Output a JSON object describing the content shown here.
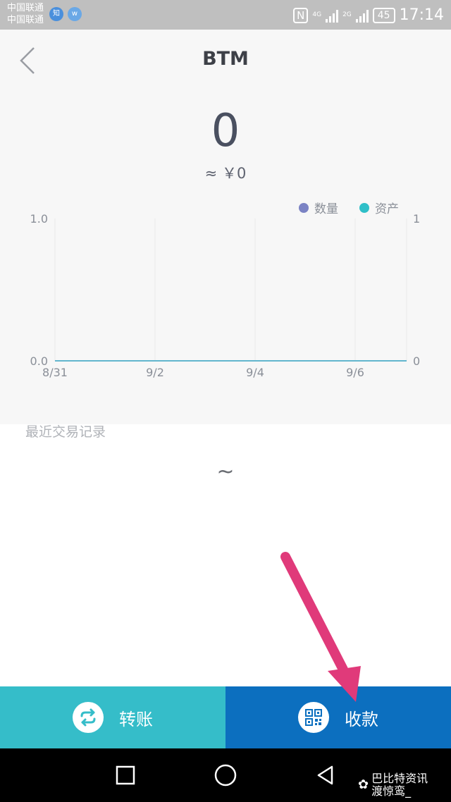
{
  "status_bar": {
    "carrier_1": "中国联通",
    "carrier_2": "中国联通",
    "app_icon_1": "知",
    "app_icon_2": "w",
    "network_1": "4G",
    "network_2": "2G",
    "battery": "45",
    "time": "17:14"
  },
  "header": {
    "title": "BTM",
    "balance": "0",
    "fiat_value": "≈ ￥0"
  },
  "chart_data": {
    "type": "line",
    "legend": [
      {
        "label": "数量",
        "color": "#7b83c4"
      },
      {
        "label": "资产",
        "color": "#2fbfc8"
      }
    ],
    "x_ticks": [
      "8/31",
      "9/2",
      "9/4",
      "9/6"
    ],
    "y_left_ticks": [
      "1.0",
      "0.0"
    ],
    "y_right_ticks": [
      "1",
      "0"
    ],
    "ylim_left": [
      0,
      1
    ],
    "ylim_right": [
      0,
      1
    ],
    "series": [
      {
        "name": "数量",
        "x": [
          "8/31",
          "9/2",
          "9/4",
          "9/6"
        ],
        "values": [
          0,
          0,
          0,
          0
        ],
        "color": "#7b83c4"
      },
      {
        "name": "资产",
        "x": [
          "8/31",
          "9/2",
          "9/4",
          "9/6"
        ],
        "values": [
          0,
          0,
          0,
          0
        ],
        "color": "#2fbfc8"
      }
    ],
    "grid": "vertical",
    "legend_position": "top-right"
  },
  "records": {
    "heading": "最近交易记录",
    "empty_text": "~"
  },
  "actions": {
    "transfer_label": "转账",
    "receive_label": "收款",
    "transfer_color": "#35bdc9",
    "receive_color": "#0c6fbf"
  },
  "watermark": {
    "line_1": "巴比特资讯",
    "line_2": "渡惊鸾_"
  },
  "annotation_color": "#e03a7a"
}
